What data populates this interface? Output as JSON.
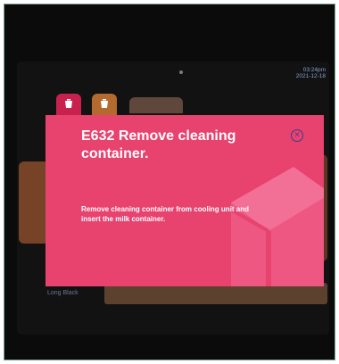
{
  "status": {
    "time": "03:24pm",
    "date": "2021-12-18"
  },
  "tabs": [
    {
      "icon": "cup-icon"
    },
    {
      "icon": "cup-icon"
    }
  ],
  "dialog": {
    "title": "E632 Remove cleaning container.",
    "message": "Remove cleaning container from cooling unit and insert the milk container.",
    "close_symbol": "×",
    "background_color": "#e8426e"
  },
  "background_menu": {
    "items": [
      "Long Black"
    ]
  }
}
